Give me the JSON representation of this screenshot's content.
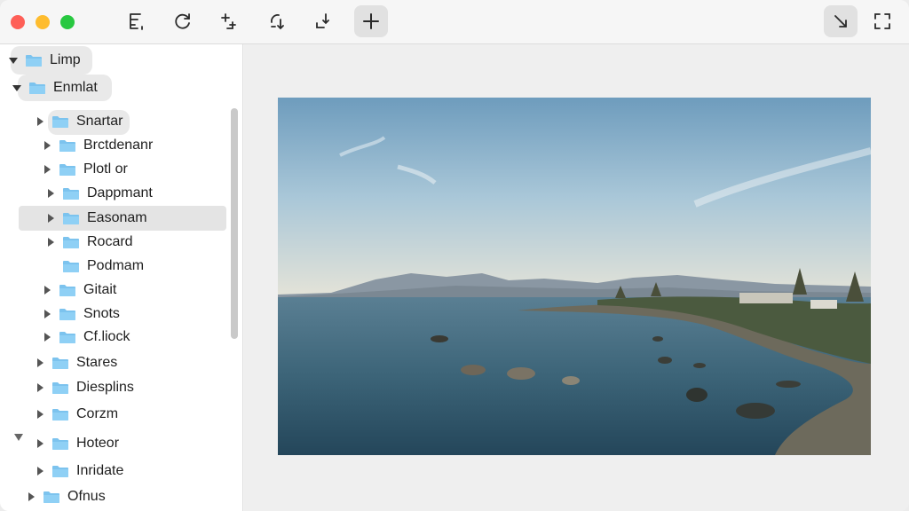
{
  "sidebar": {
    "items": [
      {
        "label": "Limp"
      },
      {
        "label": "Enmlat"
      },
      {
        "label": "Snartar"
      },
      {
        "label": "Brctdenanr"
      },
      {
        "label": "Plotl or"
      },
      {
        "label": "Dappmant"
      },
      {
        "label": "Easonam"
      },
      {
        "label": "Rocard"
      },
      {
        "label": "Podmam"
      },
      {
        "label": "Gitait"
      },
      {
        "label": "Snots"
      },
      {
        "label": "Cf.liock"
      },
      {
        "label": "Stares"
      },
      {
        "label": "Diesplins"
      },
      {
        "label": "Corzm"
      },
      {
        "label": "Hoteor"
      },
      {
        "label": "Inridate"
      },
      {
        "label": "Ofnus"
      }
    ]
  },
  "toolbar": {
    "icons": [
      "list-icon",
      "rotate-icon",
      "add-crop-icon",
      "rotate-down-icon",
      "download-icon",
      "plus-icon",
      "resize-arrow-icon",
      "fullscreen-icon"
    ]
  },
  "colors": {
    "folder": "#7cc3ee",
    "traffic_red": "#fe5f57",
    "traffic_yellow": "#febc2e",
    "traffic_green": "#28c840"
  }
}
